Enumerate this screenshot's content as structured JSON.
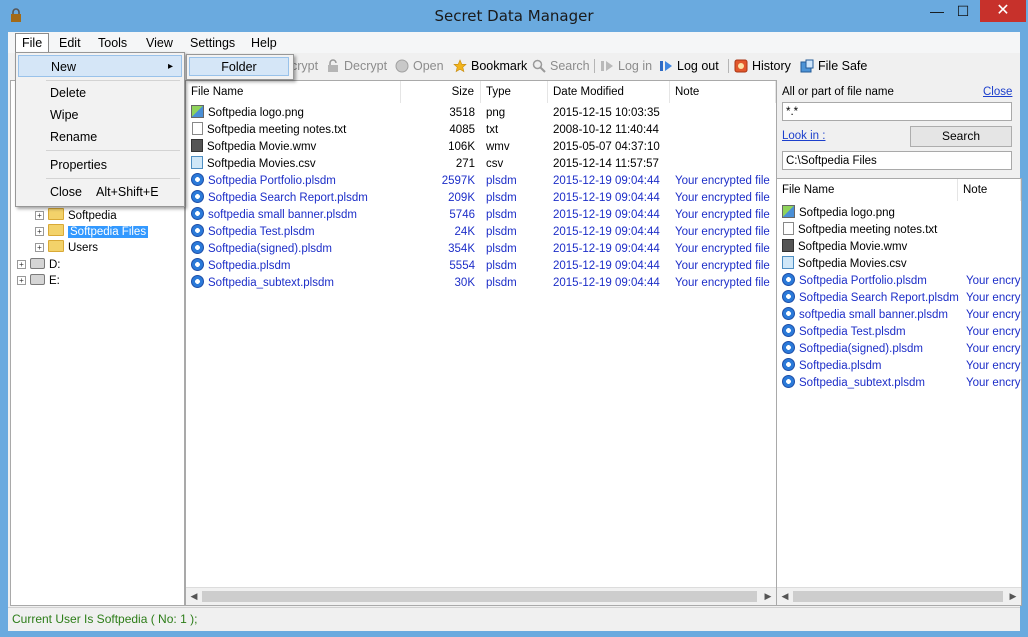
{
  "window": {
    "title": "Secret Data Manager",
    "app_icon": "lock-icon",
    "minimize_glyph": "—",
    "maximize_glyph": "☐",
    "close_glyph": "✕"
  },
  "menubar": {
    "items": [
      "File",
      "Edit",
      "Tools",
      "View",
      "Settings",
      "Help"
    ]
  },
  "file_menu": {
    "new": "New",
    "new_arrow": "▸",
    "delete": "Delete",
    "wipe": "Wipe",
    "rename": "Rename",
    "properties": "Properties",
    "close": "Close",
    "close_shortcut": "Alt+Shift+E"
  },
  "new_submenu": {
    "folder": "Folder"
  },
  "toolbar": {
    "encrypt": "crypt",
    "decrypt": "Decrypt",
    "open": "Open",
    "bookmark": "Bookmark",
    "search": "Search",
    "login": "Log in",
    "logout": "Log out",
    "history": "History",
    "filesafe": "File Safe"
  },
  "tree": {
    "nodes": [
      {
        "label": "Softpedia",
        "type": "folder",
        "expander": "+"
      },
      {
        "label": "Softpedia Files",
        "type": "folder",
        "expander": "+",
        "selected": true
      },
      {
        "label": "Users",
        "type": "folder",
        "expander": "+"
      },
      {
        "label": "D:",
        "type": "drive",
        "expander": "+"
      },
      {
        "label": "E:",
        "type": "drive",
        "expander": "+"
      }
    ]
  },
  "filelist": {
    "columns": [
      "File Name",
      "Size",
      "Type",
      "Date Modified",
      "Note"
    ],
    "rows": [
      {
        "name": "Softpedia logo.png",
        "size": "3518",
        "type": "png",
        "date": "2015-12-15 10:03:35",
        "note": "",
        "icon": "image-file-icon",
        "enc": false
      },
      {
        "name": "Softpedia meeting notes.txt",
        "size": "4085",
        "type": "txt",
        "date": "2008-10-12 11:40:44",
        "note": "",
        "icon": "text-file-icon",
        "enc": false
      },
      {
        "name": "Softpedia Movie.wmv",
        "size": "106K",
        "type": "wmv",
        "date": "2015-05-07 04:37:10",
        "note": "",
        "icon": "video-file-icon",
        "enc": false
      },
      {
        "name": "Softpedia Movies.csv",
        "size": "271",
        "type": "csv",
        "date": "2015-12-14 11:57:57",
        "note": "",
        "icon": "csv-file-icon",
        "enc": false
      },
      {
        "name": "Softpedia Portfolio.plsdm",
        "size": "2597K",
        "type": "plsdm",
        "date": "2015-12-19 09:04:44",
        "note": "Your encrypted file",
        "icon": "encrypted-file-icon",
        "enc": true
      },
      {
        "name": "Softpedia Search Report.plsdm",
        "size": "209K",
        "type": "plsdm",
        "date": "2015-12-19 09:04:44",
        "note": "Your encrypted file",
        "icon": "encrypted-file-icon",
        "enc": true
      },
      {
        "name": "softpedia small banner.plsdm",
        "size": "5746",
        "type": "plsdm",
        "date": "2015-12-19 09:04:44",
        "note": "Your encrypted file",
        "icon": "encrypted-file-icon",
        "enc": true
      },
      {
        "name": "Softpedia Test.plsdm",
        "size": "24K",
        "type": "plsdm",
        "date": "2015-12-19 09:04:44",
        "note": "Your encrypted file",
        "icon": "encrypted-file-icon",
        "enc": true
      },
      {
        "name": "Softpedia(signed).plsdm",
        "size": "354K",
        "type": "plsdm",
        "date": "2015-12-19 09:04:44",
        "note": "Your encrypted file",
        "icon": "encrypted-file-icon",
        "enc": true
      },
      {
        "name": "Softpedia.plsdm",
        "size": "5554",
        "type": "plsdm",
        "date": "2015-12-19 09:04:44",
        "note": "Your encrypted file",
        "icon": "encrypted-file-icon",
        "enc": true
      },
      {
        "name": "Softpedia_subtext.plsdm",
        "size": "30K",
        "type": "plsdm",
        "date": "2015-12-19 09:04:44",
        "note": "Your encrypted file",
        "icon": "encrypted-file-icon",
        "enc": true
      }
    ]
  },
  "search_panel": {
    "label": "All or part of file name",
    "close_link": "Close",
    "pattern_value": "*.*",
    "look_in_link": "Look in :",
    "search_button": "Search",
    "look_in_value": "C:\\Softpedia Files"
  },
  "results": {
    "columns": [
      "File Name",
      "Note"
    ],
    "rows": [
      {
        "name": "Softpedia logo.png",
        "note": "",
        "icon": "image-file-icon",
        "enc": false
      },
      {
        "name": "Softpedia meeting notes.txt",
        "note": "",
        "icon": "text-file-icon",
        "enc": false
      },
      {
        "name": "Softpedia Movie.wmv",
        "note": "",
        "icon": "video-file-icon",
        "enc": false
      },
      {
        "name": "Softpedia Movies.csv",
        "note": "",
        "icon": "csv-file-icon",
        "enc": false
      },
      {
        "name": "Softpedia Portfolio.plsdm",
        "note": "Your encry",
        "icon": "encrypted-file-icon",
        "enc": true
      },
      {
        "name": "Softpedia Search Report.plsdm",
        "note": "Your encry",
        "icon": "encrypted-file-icon",
        "enc": true
      },
      {
        "name": "softpedia small banner.plsdm",
        "note": "Your encry",
        "icon": "encrypted-file-icon",
        "enc": true
      },
      {
        "name": "Softpedia Test.plsdm",
        "note": "Your encry",
        "icon": "encrypted-file-icon",
        "enc": true
      },
      {
        "name": "Softpedia(signed).plsdm",
        "note": "Your encry",
        "icon": "encrypted-file-icon",
        "enc": true
      },
      {
        "name": "Softpedia.plsdm",
        "note": "Your encry",
        "icon": "encrypted-file-icon",
        "enc": true
      },
      {
        "name": "Softpedia_subtext.plsdm",
        "note": "Your encry",
        "icon": "encrypted-file-icon",
        "enc": true
      }
    ]
  },
  "status": {
    "text": "Current User Is Softpedia ( No: 1 );"
  },
  "colors": {
    "frame": "#6aaadf",
    "encrypted_text": "#1d2ec8",
    "status_text": "#2c7d18",
    "close_button": "#c7312b",
    "selection": "#3399ff"
  }
}
